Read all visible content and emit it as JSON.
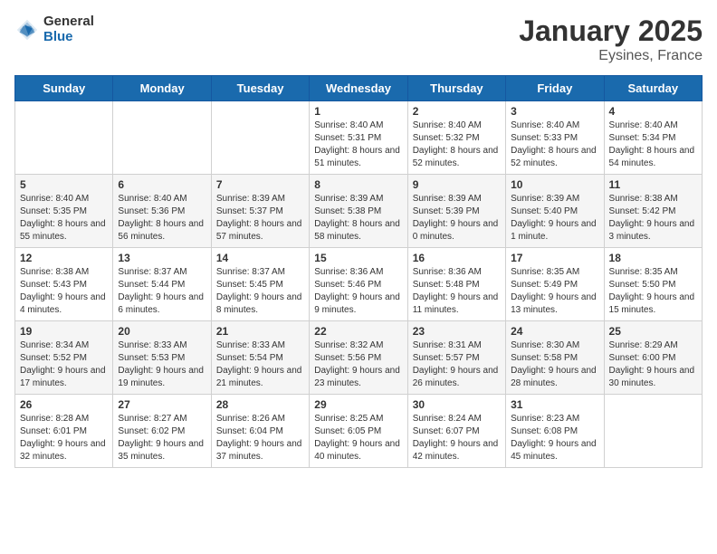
{
  "logo": {
    "general": "General",
    "blue": "Blue"
  },
  "header": {
    "month": "January 2025",
    "location": "Eysines, France"
  },
  "days_of_week": [
    "Sunday",
    "Monday",
    "Tuesday",
    "Wednesday",
    "Thursday",
    "Friday",
    "Saturday"
  ],
  "weeks": [
    [
      {
        "day": "",
        "info": ""
      },
      {
        "day": "",
        "info": ""
      },
      {
        "day": "",
        "info": ""
      },
      {
        "day": "1",
        "info": "Sunrise: 8:40 AM\nSunset: 5:31 PM\nDaylight: 8 hours and 51 minutes."
      },
      {
        "day": "2",
        "info": "Sunrise: 8:40 AM\nSunset: 5:32 PM\nDaylight: 8 hours and 52 minutes."
      },
      {
        "day": "3",
        "info": "Sunrise: 8:40 AM\nSunset: 5:33 PM\nDaylight: 8 hours and 52 minutes."
      },
      {
        "day": "4",
        "info": "Sunrise: 8:40 AM\nSunset: 5:34 PM\nDaylight: 8 hours and 54 minutes."
      }
    ],
    [
      {
        "day": "5",
        "info": "Sunrise: 8:40 AM\nSunset: 5:35 PM\nDaylight: 8 hours and 55 minutes."
      },
      {
        "day": "6",
        "info": "Sunrise: 8:40 AM\nSunset: 5:36 PM\nDaylight: 8 hours and 56 minutes."
      },
      {
        "day": "7",
        "info": "Sunrise: 8:39 AM\nSunset: 5:37 PM\nDaylight: 8 hours and 57 minutes."
      },
      {
        "day": "8",
        "info": "Sunrise: 8:39 AM\nSunset: 5:38 PM\nDaylight: 8 hours and 58 minutes."
      },
      {
        "day": "9",
        "info": "Sunrise: 8:39 AM\nSunset: 5:39 PM\nDaylight: 9 hours and 0 minutes."
      },
      {
        "day": "10",
        "info": "Sunrise: 8:39 AM\nSunset: 5:40 PM\nDaylight: 9 hours and 1 minute."
      },
      {
        "day": "11",
        "info": "Sunrise: 8:38 AM\nSunset: 5:42 PM\nDaylight: 9 hours and 3 minutes."
      }
    ],
    [
      {
        "day": "12",
        "info": "Sunrise: 8:38 AM\nSunset: 5:43 PM\nDaylight: 9 hours and 4 minutes."
      },
      {
        "day": "13",
        "info": "Sunrise: 8:37 AM\nSunset: 5:44 PM\nDaylight: 9 hours and 6 minutes."
      },
      {
        "day": "14",
        "info": "Sunrise: 8:37 AM\nSunset: 5:45 PM\nDaylight: 9 hours and 8 minutes."
      },
      {
        "day": "15",
        "info": "Sunrise: 8:36 AM\nSunset: 5:46 PM\nDaylight: 9 hours and 9 minutes."
      },
      {
        "day": "16",
        "info": "Sunrise: 8:36 AM\nSunset: 5:48 PM\nDaylight: 9 hours and 11 minutes."
      },
      {
        "day": "17",
        "info": "Sunrise: 8:35 AM\nSunset: 5:49 PM\nDaylight: 9 hours and 13 minutes."
      },
      {
        "day": "18",
        "info": "Sunrise: 8:35 AM\nSunset: 5:50 PM\nDaylight: 9 hours and 15 minutes."
      }
    ],
    [
      {
        "day": "19",
        "info": "Sunrise: 8:34 AM\nSunset: 5:52 PM\nDaylight: 9 hours and 17 minutes."
      },
      {
        "day": "20",
        "info": "Sunrise: 8:33 AM\nSunset: 5:53 PM\nDaylight: 9 hours and 19 minutes."
      },
      {
        "day": "21",
        "info": "Sunrise: 8:33 AM\nSunset: 5:54 PM\nDaylight: 9 hours and 21 minutes."
      },
      {
        "day": "22",
        "info": "Sunrise: 8:32 AM\nSunset: 5:56 PM\nDaylight: 9 hours and 23 minutes."
      },
      {
        "day": "23",
        "info": "Sunrise: 8:31 AM\nSunset: 5:57 PM\nDaylight: 9 hours and 26 minutes."
      },
      {
        "day": "24",
        "info": "Sunrise: 8:30 AM\nSunset: 5:58 PM\nDaylight: 9 hours and 28 minutes."
      },
      {
        "day": "25",
        "info": "Sunrise: 8:29 AM\nSunset: 6:00 PM\nDaylight: 9 hours and 30 minutes."
      }
    ],
    [
      {
        "day": "26",
        "info": "Sunrise: 8:28 AM\nSunset: 6:01 PM\nDaylight: 9 hours and 32 minutes."
      },
      {
        "day": "27",
        "info": "Sunrise: 8:27 AM\nSunset: 6:02 PM\nDaylight: 9 hours and 35 minutes."
      },
      {
        "day": "28",
        "info": "Sunrise: 8:26 AM\nSunset: 6:04 PM\nDaylight: 9 hours and 37 minutes."
      },
      {
        "day": "29",
        "info": "Sunrise: 8:25 AM\nSunset: 6:05 PM\nDaylight: 9 hours and 40 minutes."
      },
      {
        "day": "30",
        "info": "Sunrise: 8:24 AM\nSunset: 6:07 PM\nDaylight: 9 hours and 42 minutes."
      },
      {
        "day": "31",
        "info": "Sunrise: 8:23 AM\nSunset: 6:08 PM\nDaylight: 9 hours and 45 minutes."
      },
      {
        "day": "",
        "info": ""
      }
    ]
  ]
}
